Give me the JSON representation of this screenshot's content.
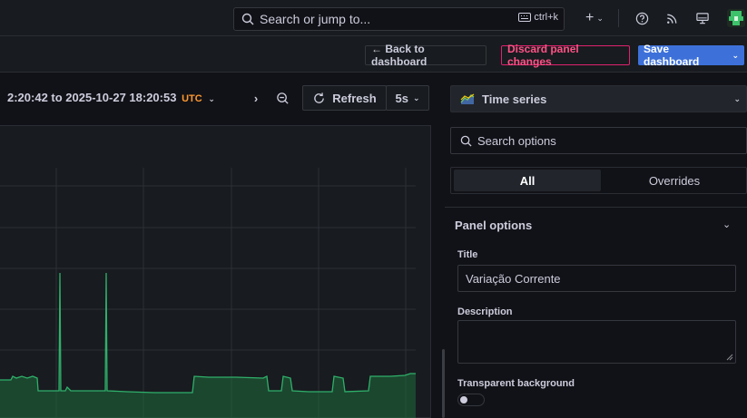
{
  "topbar": {
    "search_placeholder": "Search or jump to...",
    "shortcut": "ctrl+k",
    "add_label": "+"
  },
  "toolbar": {
    "back_label": "← Back to dashboard",
    "discard_label": "Discard panel changes",
    "save_label": "Save dashboard"
  },
  "timepicker": {
    "range": "2:20:42 to 2025-10-27 18:20:53",
    "timezone": "UTC",
    "refresh_label": "Refresh",
    "interval": "5s"
  },
  "options": {
    "visualization": "Time series",
    "search_placeholder": "Search options",
    "tabs": [
      "All",
      "Overrides"
    ],
    "active_tab": "All",
    "section": "Panel options",
    "fields": {
      "title_label": "Title",
      "title_value": "Variação Corrente",
      "description_label": "Description",
      "description_value": "",
      "transparent_label": "Transparent background",
      "transparent_on": false
    }
  },
  "colors": {
    "accent": "#3d71d9",
    "danger": "#e0226e",
    "series": "#2fb06a",
    "timezone": "#ff9830"
  }
}
